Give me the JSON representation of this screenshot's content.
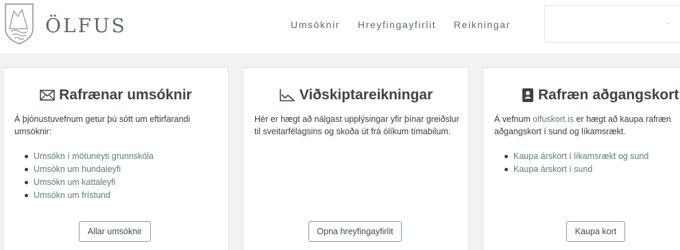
{
  "header": {
    "brand": "ÖLFUS",
    "nav": [
      "Umsóknir",
      "Hreyfingayfirlit",
      "Reikningar"
    ],
    "search_placeholder": ""
  },
  "colors": {
    "accent": "#5d7d77",
    "background": "#f2f2f2",
    "title": "#3d4543"
  },
  "cards": [
    {
      "icon": "envelope-icon",
      "title": "Rafrænar umsóknir",
      "text": "Á þjónustuvefnum getur þú sótt um eftirfarandi umsóknir:",
      "links": [
        "Umsókn í mötuneyti grunnskóla",
        "Umsókn um hundaleyfi",
        "Umsókn um kattaleyfi",
        "Umsókn um frístund"
      ],
      "button": "Allar umsóknir"
    },
    {
      "icon": "line-chart-icon",
      "title": "Viðskiptareikningar",
      "text": "Hér er hægt að nálgast upplýsingar yfir þínar greiðslur til sveitarfélagsins og skoða út frá ólíkum tímabilum.",
      "button": "Opna hreyfingayfirlit"
    },
    {
      "icon": "id-card-icon",
      "title": "Rafræn aðgangskort",
      "text_before": "Á vefnum ",
      "text_link": "olfuskort.is",
      "text_after": " er hægt að kaupa rafræn aðgangskort í sund og líkamsrækt.",
      "links": [
        "Kaupa árskort í líkamsrækt og sund",
        "Kaupa árskort í sund"
      ],
      "button": "Kaupa kort"
    }
  ]
}
